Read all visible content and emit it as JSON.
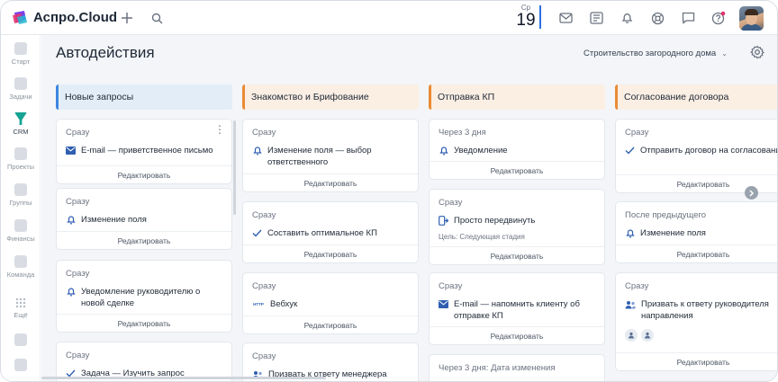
{
  "app": {
    "brand": "Аспро.Cloud",
    "date_dow": "Ср",
    "date_num": "19",
    "icons": [
      "plus-icon",
      "search-icon",
      "mail-icon",
      "news-icon",
      "bell-icon",
      "support-icon",
      "chat-icon",
      "help-icon"
    ]
  },
  "colors": {
    "accent": "#2f6fe0",
    "col_blue": "#e3edf8",
    "col_blue_border": "#3f86e0",
    "col_peach": "#fbeee3",
    "col_peach_border": "#e98b34"
  },
  "sidebar": {
    "items": [
      {
        "label": "Старт",
        "icon": "start-icon"
      },
      {
        "label": "Задачи",
        "icon": "tasks-icon"
      },
      {
        "label": "CRM",
        "icon": "crm-icon"
      },
      {
        "label": "Проекты",
        "icon": "projects-icon"
      },
      {
        "label": "Группы",
        "icon": "groups-icon"
      },
      {
        "label": "Финансы",
        "icon": "finance-icon"
      },
      {
        "label": "Команда",
        "icon": "team-icon"
      },
      {
        "label": "Ещё",
        "icon": "more-icon"
      }
    ]
  },
  "page": {
    "title": "Автодействия",
    "project": "Строительство загородного дома"
  },
  "columns": [
    {
      "title": "Новые запросы",
      "cards": [
        {
          "when": "Сразу",
          "icon": "mail-icon",
          "action": "E-mail — приветственное письмо",
          "edit": "Редактировать"
        },
        {
          "when": "Сразу",
          "icon": "bell-icon",
          "action": "Изменение поля",
          "edit": "Редактировать"
        },
        {
          "when": "Сразу",
          "icon": "bell-icon",
          "action": "Уведомление руководителю о новой сделке",
          "edit": "Редактировать"
        },
        {
          "when": "Сразу",
          "icon": "check-icon",
          "action": "Задача — Изучить запрос",
          "edit": ""
        }
      ]
    },
    {
      "title": "Знакомство и Брифование",
      "cards": [
        {
          "when": "Сразу",
          "icon": "bell-icon",
          "action": "Изменение поля — выбор ответственного",
          "edit": "Редактировать"
        },
        {
          "when": "Сразу",
          "icon": "check-icon",
          "action": "Составить оптимальное КП",
          "edit": "Редактировать"
        },
        {
          "when": "Сразу",
          "icon": "webhook-icon",
          "icon_text": "HTTP",
          "action": "Вебхук",
          "edit": "Редактировать"
        },
        {
          "when": "Сразу",
          "icon": "users-icon",
          "action": "Призвать к ответу менеджера",
          "edit": ""
        }
      ]
    },
    {
      "title": "Отправка КП",
      "cards": [
        {
          "when": "Через 3 дня",
          "icon": "bell-icon",
          "action": "Уведомление",
          "edit": "Редактировать"
        },
        {
          "when": "Сразу",
          "icon": "move-icon",
          "action": "Просто передвинуть",
          "sub": "Цель: Следующая стадия",
          "edit": "Редактировать"
        },
        {
          "when": "Сразу",
          "icon": "mail-icon",
          "action": "E-mail — напомнить клиенту об отправке КП",
          "edit": "Редактировать"
        },
        {
          "when": "Через 3 дня: Дата изменения",
          "icon": "",
          "action": "",
          "edit": ""
        }
      ]
    },
    {
      "title": "Согласование договора",
      "cards": [
        {
          "when": "Сразу",
          "icon": "check-icon",
          "action": "Отправить договор на согласование",
          "edit": "Редактировать"
        },
        {
          "when": "После предыдущего",
          "icon": "bell-icon",
          "action": "Изменение поля",
          "edit": "Редактировать"
        },
        {
          "when": "Сразу",
          "icon": "users-icon",
          "action": "Призвать к ответу руководителя направления",
          "edit": "Редактировать"
        }
      ]
    }
  ]
}
